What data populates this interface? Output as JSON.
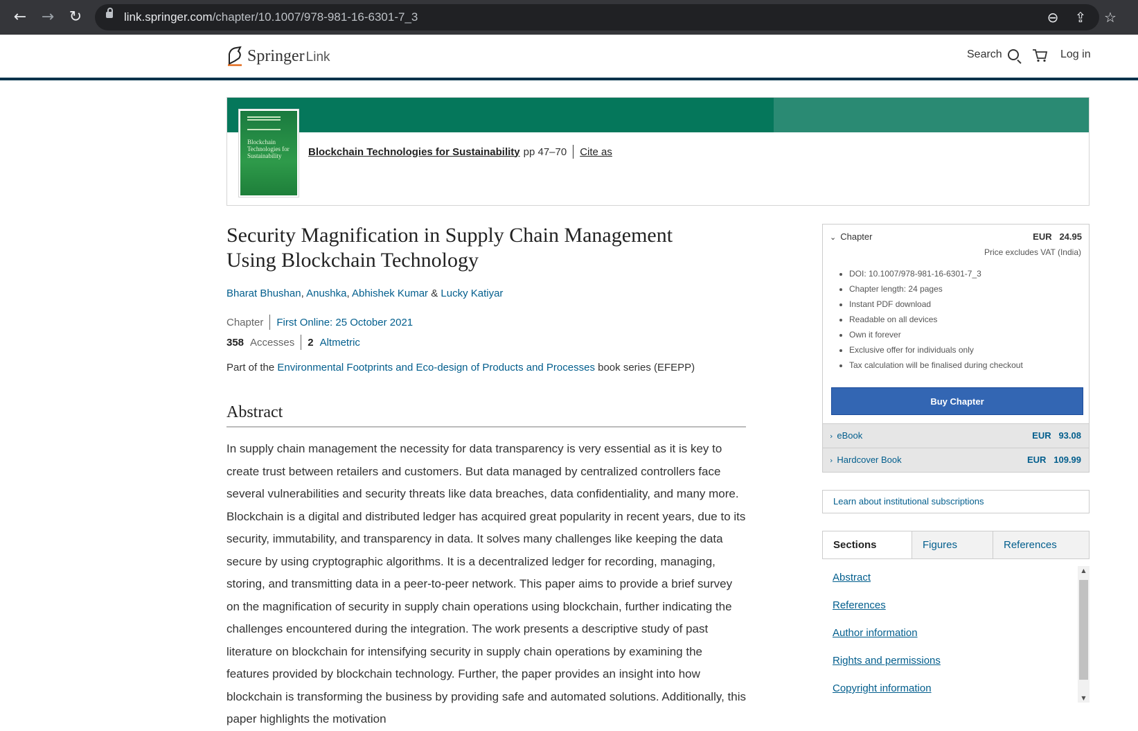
{
  "browser": {
    "back_icon": "←",
    "forward_icon": "→",
    "reload_icon": "↻",
    "url_host": "link.springer.com",
    "url_path": "/chapter/10.1007/978-981-16-6301-7_3",
    "zoom_icon": "⊖",
    "share_icon": "⇪",
    "star_icon": "☆"
  },
  "header": {
    "logo_main": "Springer",
    "logo_link": "Link",
    "search_label": "Search",
    "login_label": "Log in"
  },
  "banner": {
    "cover_title": "Blockchain Technologies for Sustainability",
    "book_title": "Blockchain Technologies for Sustainability",
    "pages": "pp 47–70",
    "cite_as": "Cite as"
  },
  "article": {
    "title": "Security Magnification in Supply Chain Management Using Blockchain Technology",
    "authors": [
      "Bharat Bhushan",
      "Anushka",
      "Abhishek Kumar",
      "Lucky Katiyar"
    ],
    "author_sep_1": ", ",
    "author_sep_2": ", ",
    "author_sep_3": " & ",
    "type": "Chapter",
    "first_online": "First Online: 25 October 2021",
    "accesses_count": "358",
    "accesses_label": "Accesses",
    "altmetric_count": "2",
    "altmetric_label": "Altmetric",
    "series_prefix": "Part of the ",
    "series_name": "Environmental Footprints and Eco-design of Products and Processes",
    "series_suffix": " book series (EFEPP)",
    "abstract_heading": "Abstract",
    "abstract_text": "In supply chain management the necessity for data transparency is very essential as it is key to create trust between retailers and customers. But data managed by centralized controllers face several vulnerabilities and security threats like data breaches, data confidentiality, and many more. Blockchain is a digital and distributed ledger has acquired great popularity in recent years, due to its security, immutability, and transparency in data. It solves many challenges like keeping the data secure by using cryptographic algorithms. It is a decentralized ledger for recording, managing, storing, and transmitting data in a peer-to-peer network. This paper aims to provide a brief survey on the magnification of security in supply chain operations using blockchain, further indicating the challenges encountered during the integration. The work presents a descriptive study of past literature on blockchain for intensifying security in supply chain operations by examining the features provided by blockchain technology. Further, the paper provides an insight into how blockchain is transforming the business by providing safe and automated solutions. Additionally, this paper highlights the motivation"
  },
  "buy_box": {
    "chapter_label": "Chapter",
    "currency": "EUR",
    "chapter_price": "24.95",
    "vat_note": "Price excludes VAT (India)",
    "features": [
      "DOI: 10.1007/978-981-16-6301-7_3",
      "Chapter length: 24 pages",
      "Instant PDF download",
      "Readable on all devices",
      "Own it forever",
      "Exclusive offer for individuals only",
      "Tax calculation will be finalised during checkout"
    ],
    "buy_label": "Buy Chapter",
    "options": [
      {
        "label": "eBook",
        "currency": "EUR",
        "price": "93.08"
      },
      {
        "label": "Hardcover Book",
        "currency": "EUR",
        "price": "109.99"
      }
    ],
    "institutional": "Learn about institutional subscriptions"
  },
  "sidebar": {
    "tabs": [
      "Sections",
      "Figures",
      "References"
    ],
    "sections": [
      "Abstract",
      "References",
      "Author information",
      "Rights and permissions",
      "Copyright information"
    ]
  },
  "colors": {
    "banner_green": "#05775b",
    "link_blue": "#025e8d",
    "buy_button": "#3366b3",
    "header_rule": "#01324b"
  }
}
